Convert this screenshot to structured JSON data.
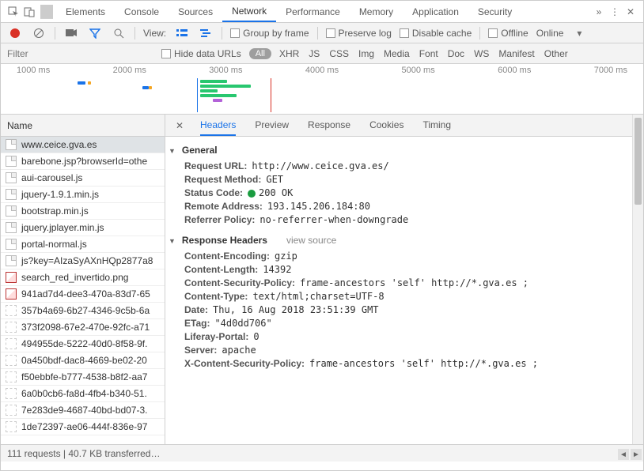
{
  "topbar": {
    "tabs": [
      "Elements",
      "Console",
      "Sources",
      "Network",
      "Performance",
      "Memory",
      "Application",
      "Security"
    ],
    "active": "Network",
    "more_icon": "chevrons-right-icon",
    "menu_icon": "kebab-icon",
    "close_icon": "close-icon",
    "inspect_icon": "inspect-icon",
    "device_icon": "device-toggle-icon"
  },
  "toolbar": {
    "view_label": "View:",
    "group_by_frame": "Group by frame",
    "preserve_log": "Preserve log",
    "disable_cache": "Disable cache",
    "offline": "Offline",
    "online": "Online"
  },
  "filterbar": {
    "placeholder": "Filter",
    "hide_data_urls": "Hide data URLs",
    "all": "All",
    "types": [
      "XHR",
      "JS",
      "CSS",
      "Img",
      "Media",
      "Font",
      "Doc",
      "WS",
      "Manifest",
      "Other"
    ]
  },
  "timeline": {
    "ticks": [
      "1000 ms",
      "2000 ms",
      "3000 ms",
      "4000 ms",
      "5000 ms",
      "6000 ms",
      "7000 ms"
    ]
  },
  "requests": {
    "header": "Name",
    "items": [
      {
        "icon": "doc",
        "name": "www.ceice.gva.es",
        "selected": true
      },
      {
        "icon": "doc",
        "name": "barebone.jsp?browserId=othe"
      },
      {
        "icon": "doc",
        "name": "aui-carousel.js"
      },
      {
        "icon": "doc",
        "name": "jquery-1.9.1.min.js"
      },
      {
        "icon": "doc",
        "name": "bootstrap.min.js"
      },
      {
        "icon": "doc",
        "name": "jquery.jplayer.min.js"
      },
      {
        "icon": "doc",
        "name": "portal-normal.js"
      },
      {
        "icon": "doc",
        "name": "js?key=AIzaSyAXnHQp2877a8"
      },
      {
        "icon": "img",
        "name": "search_red_invertido.png"
      },
      {
        "icon": "img",
        "name": "941ad7d4-dee3-470a-83d7-65"
      },
      {
        "icon": "blank",
        "name": "357b4a69-6b27-4346-9c5b-6a"
      },
      {
        "icon": "blank",
        "name": "373f2098-67e2-470e-92fc-a71"
      },
      {
        "icon": "blank",
        "name": "494955de-5222-40d0-8f58-9f."
      },
      {
        "icon": "blank",
        "name": "0a450bdf-dac8-4669-be02-20"
      },
      {
        "icon": "blank",
        "name": "f50ebbfe-b777-4538-b8f2-aa7"
      },
      {
        "icon": "blank",
        "name": "6a0b0cb6-fa8d-4fb4-b340-51."
      },
      {
        "icon": "blank",
        "name": "7e283de9-4687-40bd-bd07-3."
      },
      {
        "icon": "blank",
        "name": "1de72397-ae06-444f-836e-97"
      }
    ]
  },
  "detail": {
    "tabs": [
      "Headers",
      "Preview",
      "Response",
      "Cookies",
      "Timing"
    ],
    "active": "Headers",
    "general": {
      "title": "General",
      "request_url_k": "Request URL:",
      "request_url_v": "http://www.ceice.gva.es/",
      "request_method_k": "Request Method:",
      "request_method_v": "GET",
      "status_code_k": "Status Code:",
      "status_code_v": "200 OK",
      "remote_addr_k": "Remote Address:",
      "remote_addr_v": "193.145.206.184:80",
      "referrer_policy_k": "Referrer Policy:",
      "referrer_policy_v": "no-referrer-when-downgrade"
    },
    "response_headers": {
      "title": "Response Headers",
      "view_source": "view source",
      "items": [
        {
          "k": "Content-Encoding:",
          "v": "gzip"
        },
        {
          "k": "Content-Length:",
          "v": "14392"
        },
        {
          "k": "Content-Security-Policy:",
          "v": "frame-ancestors 'self' http://*.gva.es ;"
        },
        {
          "k": "Content-Type:",
          "v": "text/html;charset=UTF-8"
        },
        {
          "k": "Date:",
          "v": "Thu, 16 Aug 2018 23:51:39 GMT"
        },
        {
          "k": "ETag:",
          "v": "\"4d0dd706\""
        },
        {
          "k": "Liferay-Portal:",
          "v": "0"
        },
        {
          "k": "Server:",
          "v": "apache"
        },
        {
          "k": "X-Content-Security-Policy:",
          "v": "frame-ancestors 'self' http://*.gva.es ;"
        }
      ]
    }
  },
  "statusbar": {
    "text": "111 requests | 40.7 KB transferred…"
  }
}
